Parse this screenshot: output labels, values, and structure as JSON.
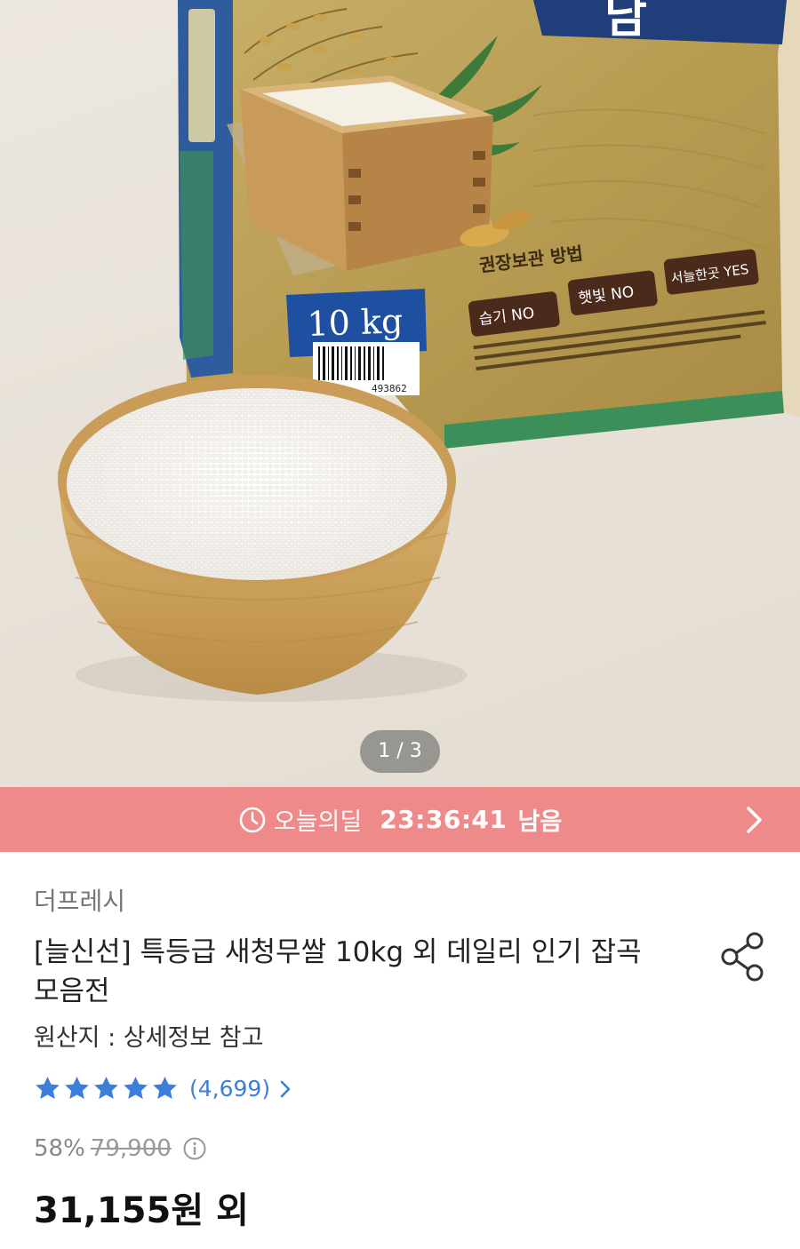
{
  "gallery": {
    "counter": "1 / 3",
    "package": {
      "weight_label": "10 kg",
      "storage_title": "권장보관 방법",
      "storage_tags": [
        "습기 NO",
        "햇빛 NO",
        "서늘한곳 YES"
      ],
      "barcode_digits": "493862"
    }
  },
  "deal": {
    "label": "오늘의딜",
    "timer": "23:36:41",
    "remain": "남음",
    "accent_color": "#ef8a8a"
  },
  "product": {
    "seller": "더프레시",
    "title": "[늘신선] 특등급 새청무쌀 10kg 외 데일리 인기 잡곡 모음전",
    "origin": "원산지 : 상세정보 참고",
    "rating": {
      "stars": 5,
      "review_count": "(4,699)",
      "star_color": "#3b7fd9"
    },
    "discount": "58%",
    "original_price": "79,900",
    "price": "31,155원 외"
  },
  "icons": {
    "clock": "clock-icon",
    "arrow": "chevron-right-icon",
    "share": "share-icon",
    "info": "info-icon",
    "star": "star-icon"
  }
}
